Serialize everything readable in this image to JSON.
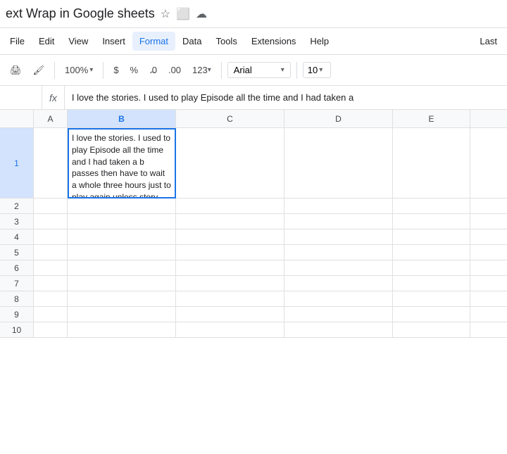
{
  "titleBar": {
    "title": "ext Wrap in Google sheets",
    "icons": [
      "star",
      "folder",
      "cloud"
    ]
  },
  "menuBar": {
    "items": [
      "File",
      "Edit",
      "View",
      "Insert",
      "Format",
      "Data",
      "Tools",
      "Extensions",
      "Help"
    ],
    "right": "Last"
  },
  "toolbar": {
    "zoom": "100%",
    "currency": "$",
    "percent": "%",
    "decimal_less": ".0",
    "decimal_more": ".00",
    "format123": "123",
    "font": "Arial",
    "fontSize": "10"
  },
  "formulaBar": {
    "cellRef": "",
    "fx": "fx",
    "content": "I love the stories. I used to play Episode all the time and I had taken a"
  },
  "columns": {
    "headers": [
      "A",
      "B",
      "C",
      "D",
      "E"
    ]
  },
  "rows": [
    {
      "num": "1",
      "b": "I love the stories. I used to play Episode all the time and I had taken a b passes then have to wait a whole three hours just to play again unless story your choices, but you have to pay to get diamonds just to make t want, or even make a good choice without paying.",
      "c": "",
      "d": "",
      "e": ""
    },
    {
      "num": "2",
      "b": "",
      "c": "",
      "d": "",
      "e": ""
    },
    {
      "num": "3",
      "b": "",
      "c": "",
      "d": "",
      "e": ""
    },
    {
      "num": "4",
      "b": "",
      "c": "",
      "d": "",
      "e": ""
    },
    {
      "num": "5",
      "b": "",
      "c": "",
      "d": "",
      "e": ""
    },
    {
      "num": "6",
      "b": "",
      "c": "",
      "d": "",
      "e": ""
    },
    {
      "num": "7",
      "b": "",
      "c": "",
      "d": "",
      "e": ""
    },
    {
      "num": "8",
      "b": "",
      "c": "",
      "d": "",
      "e": ""
    },
    {
      "num": "9",
      "b": "",
      "c": "",
      "d": "",
      "e": ""
    },
    {
      "num": "10",
      "b": "",
      "c": "",
      "d": "",
      "e": ""
    }
  ],
  "colors": {
    "selected": "#d3e3fd",
    "active_border": "#1a73e8",
    "header_bg": "#f8f9fa"
  }
}
